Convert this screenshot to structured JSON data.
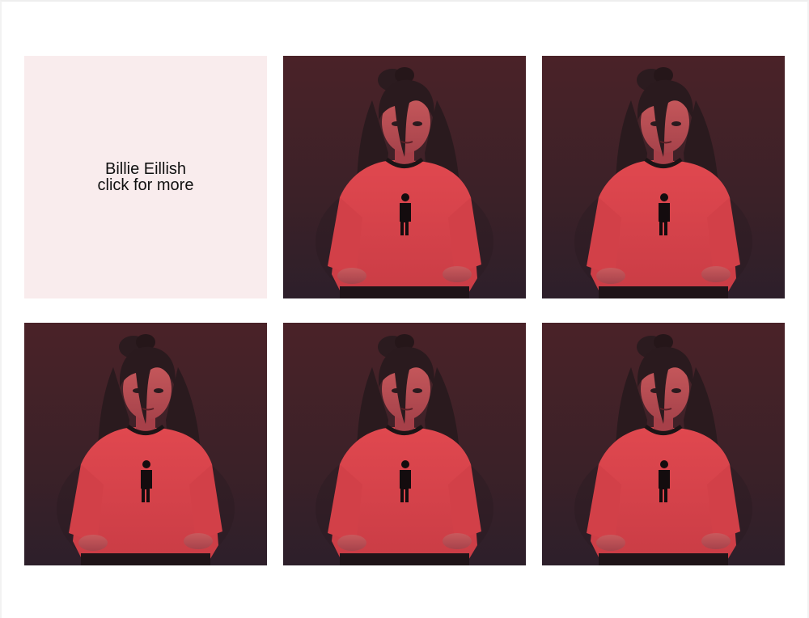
{
  "info_card": {
    "title": "Billie Eillish",
    "subtitle": "click for more"
  },
  "photos": [
    {
      "alt": "Billie Eillish"
    },
    {
      "alt": "Billie Eillish"
    },
    {
      "alt": "Billie Eillish"
    },
    {
      "alt": "Billie Eillish"
    },
    {
      "alt": "Billie Eillish"
    }
  ],
  "colors": {
    "info_card_background": "#f9eced",
    "photo_shirt": "#d8444c",
    "photo_background_top": "#4a2228",
    "photo_background_bottom": "#2d1f2a"
  }
}
